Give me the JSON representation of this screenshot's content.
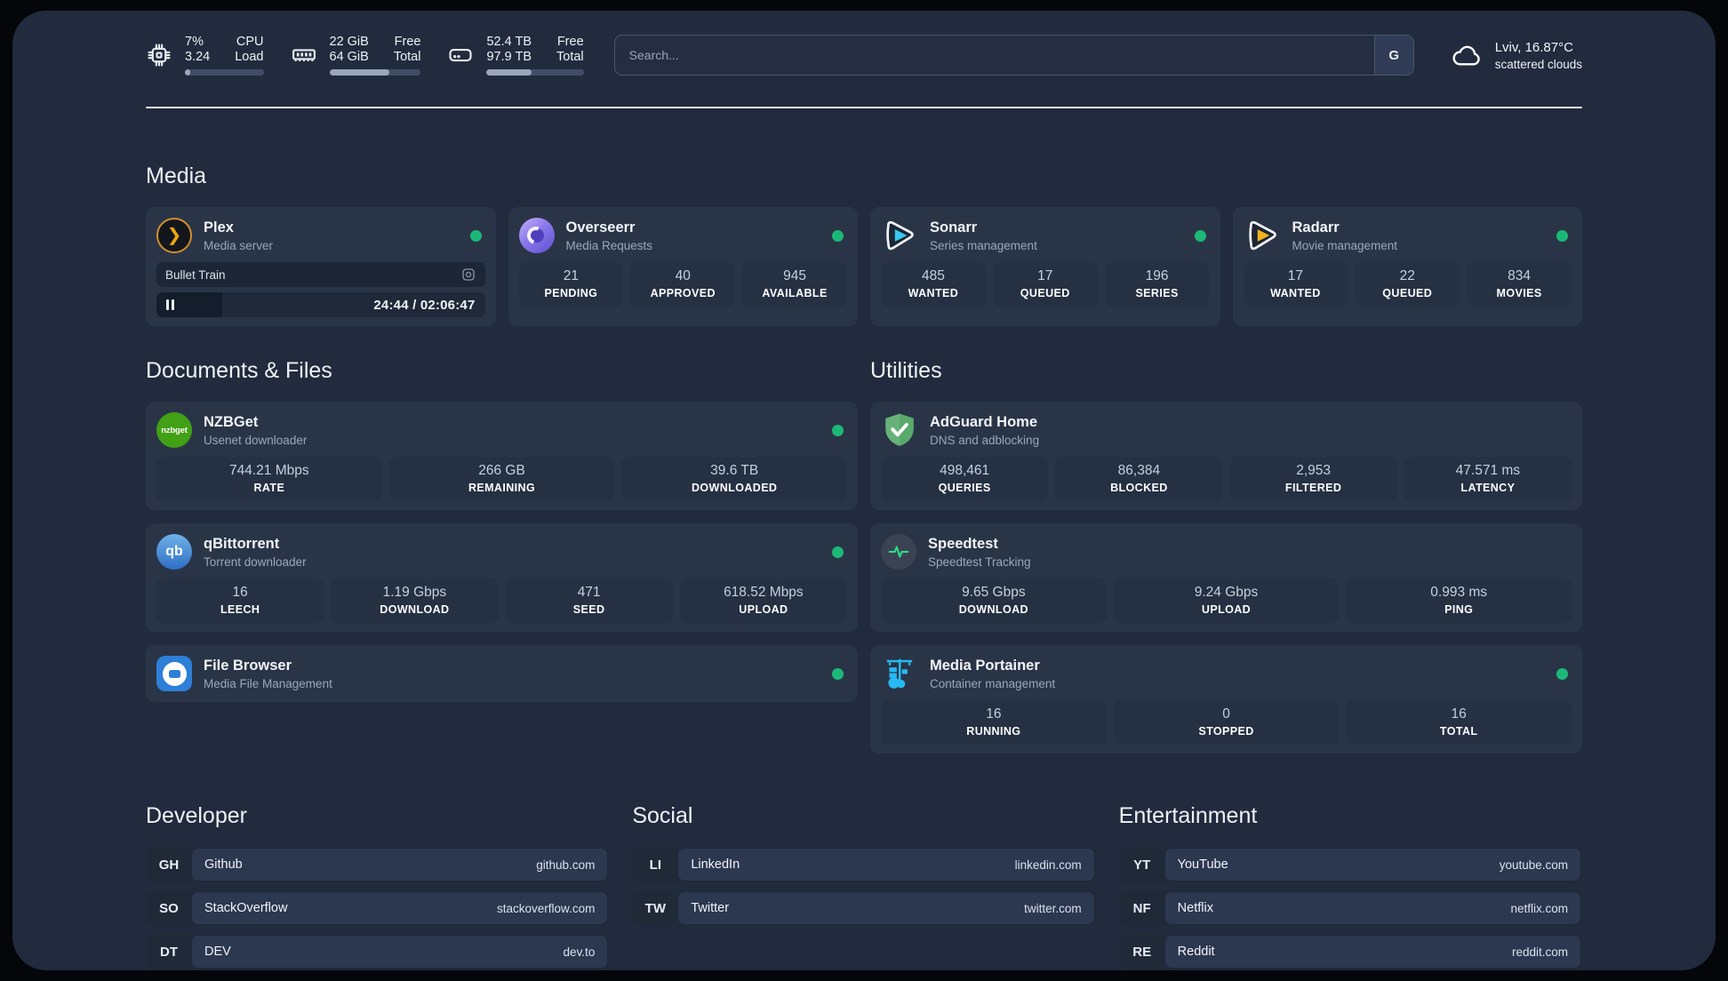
{
  "header": {
    "stats": [
      {
        "icon": "cpu-icon",
        "rows": [
          {
            "value": "7%",
            "label": "CPU"
          },
          {
            "value": "3.24",
            "label": "Load"
          }
        ],
        "progress_pct": 7
      },
      {
        "icon": "ram-icon",
        "rows": [
          {
            "value": "22 GiB",
            "label": "Free"
          },
          {
            "value": "64 GiB",
            "label": "Total"
          }
        ],
        "progress_pct": 66
      },
      {
        "icon": "disk-icon",
        "rows": [
          {
            "value": "52.4 TB",
            "label": "Free"
          },
          {
            "value": "97.9 TB",
            "label": "Total"
          }
        ],
        "progress_pct": 46
      }
    ],
    "search": {
      "placeholder": "Search...",
      "engine_button": "G"
    },
    "weather": {
      "icon": "cloud-icon",
      "location": "Lviv, 16.87°C",
      "condition": "scattered clouds"
    }
  },
  "sections": {
    "media": {
      "title": "Media",
      "cards": [
        {
          "icon": "plex-icon",
          "name": "Plex",
          "description": "Media server",
          "status": "online",
          "player": {
            "title": "Bullet Train",
            "time": "24:44 / 02:06:47",
            "progress_pct": 20
          }
        },
        {
          "icon": "overseerr-icon",
          "name": "Overseerr",
          "description": "Media Requests",
          "status": "online",
          "stats": [
            {
              "value": "21",
              "label": "PENDING"
            },
            {
              "value": "40",
              "label": "APPROVED"
            },
            {
              "value": "945",
              "label": "AVAILABLE"
            }
          ]
        },
        {
          "icon": "sonarr-icon",
          "name": "Sonarr",
          "description": "Series management",
          "status": "online",
          "stats": [
            {
              "value": "485",
              "label": "WANTED"
            },
            {
              "value": "17",
              "label": "QUEUED"
            },
            {
              "value": "196",
              "label": "SERIES"
            }
          ]
        },
        {
          "icon": "radarr-icon",
          "name": "Radarr",
          "description": "Movie management",
          "status": "online",
          "stats": [
            {
              "value": "17",
              "label": "WANTED"
            },
            {
              "value": "22",
              "label": "QUEUED"
            },
            {
              "value": "834",
              "label": "MOVIES"
            }
          ]
        }
      ]
    },
    "documents": {
      "title": "Documents & Files",
      "cards": [
        {
          "icon": "nzbget-icon",
          "name": "NZBGet",
          "description": "Usenet downloader",
          "status": "online",
          "stats": [
            {
              "value": "744.21 Mbps",
              "label": "RATE"
            },
            {
              "value": "266 GB",
              "label": "REMAINING"
            },
            {
              "value": "39.6 TB",
              "label": "DOWNLOADED"
            }
          ]
        },
        {
          "icon": "qbittorrent-icon",
          "name": "qBittorrent",
          "description": "Torrent downloader",
          "status": "online",
          "stats": [
            {
              "value": "16",
              "label": "LEECH"
            },
            {
              "value": "1.19 Gbps",
              "label": "DOWNLOAD"
            },
            {
              "value": "471",
              "label": "SEED"
            },
            {
              "value": "618.52 Mbps",
              "label": "UPLOAD"
            }
          ]
        },
        {
          "icon": "filebrowser-icon",
          "name": "File Browser",
          "description": "Media File Management",
          "status": "online"
        }
      ]
    },
    "utilities": {
      "title": "Utilities",
      "cards": [
        {
          "icon": "adguard-icon",
          "name": "AdGuard Home",
          "description": "DNS and adblocking",
          "stats": [
            {
              "value": "498,461",
              "label": "QUERIES"
            },
            {
              "value": "86,384",
              "label": "BLOCKED"
            },
            {
              "value": "2,953",
              "label": "FILTERED"
            },
            {
              "value": "47.571 ms",
              "label": "LATENCY"
            }
          ]
        },
        {
          "icon": "speedtest-icon",
          "name": "Speedtest",
          "description": "Speedtest Tracking",
          "stats": [
            {
              "value": "9.65 Gbps",
              "label": "DOWNLOAD"
            },
            {
              "value": "9.24 Gbps",
              "label": "UPLOAD"
            },
            {
              "value": "0.993 ms",
              "label": "PING"
            }
          ]
        },
        {
          "icon": "portainer-icon",
          "name": "Media Portainer",
          "description": "Container management",
          "status": "online",
          "stats": [
            {
              "value": "16",
              "label": "RUNNING"
            },
            {
              "value": "0",
              "label": "STOPPED"
            },
            {
              "value": "16",
              "label": "TOTAL"
            }
          ]
        }
      ]
    }
  },
  "bookmarks": [
    {
      "title": "Developer",
      "items": [
        {
          "abbr": "GH",
          "name": "Github",
          "url": "github.com"
        },
        {
          "abbr": "SO",
          "name": "StackOverflow",
          "url": "stackoverflow.com"
        },
        {
          "abbr": "DT",
          "name": "DEV",
          "url": "dev.to"
        }
      ]
    },
    {
      "title": "Social",
      "items": [
        {
          "abbr": "LI",
          "name": "LinkedIn",
          "url": "linkedin.com"
        },
        {
          "abbr": "TW",
          "name": "Twitter",
          "url": "twitter.com"
        }
      ]
    },
    {
      "title": "Entertainment",
      "items": [
        {
          "abbr": "YT",
          "name": "YouTube",
          "url": "youtube.com"
        },
        {
          "abbr": "NF",
          "name": "Netflix",
          "url": "netflix.com"
        },
        {
          "abbr": "RE",
          "name": "Reddit",
          "url": "reddit.com"
        }
      ]
    }
  ],
  "colors": {
    "status_online": "#1db877",
    "background": "#212b3d",
    "card": "#2a3447"
  }
}
